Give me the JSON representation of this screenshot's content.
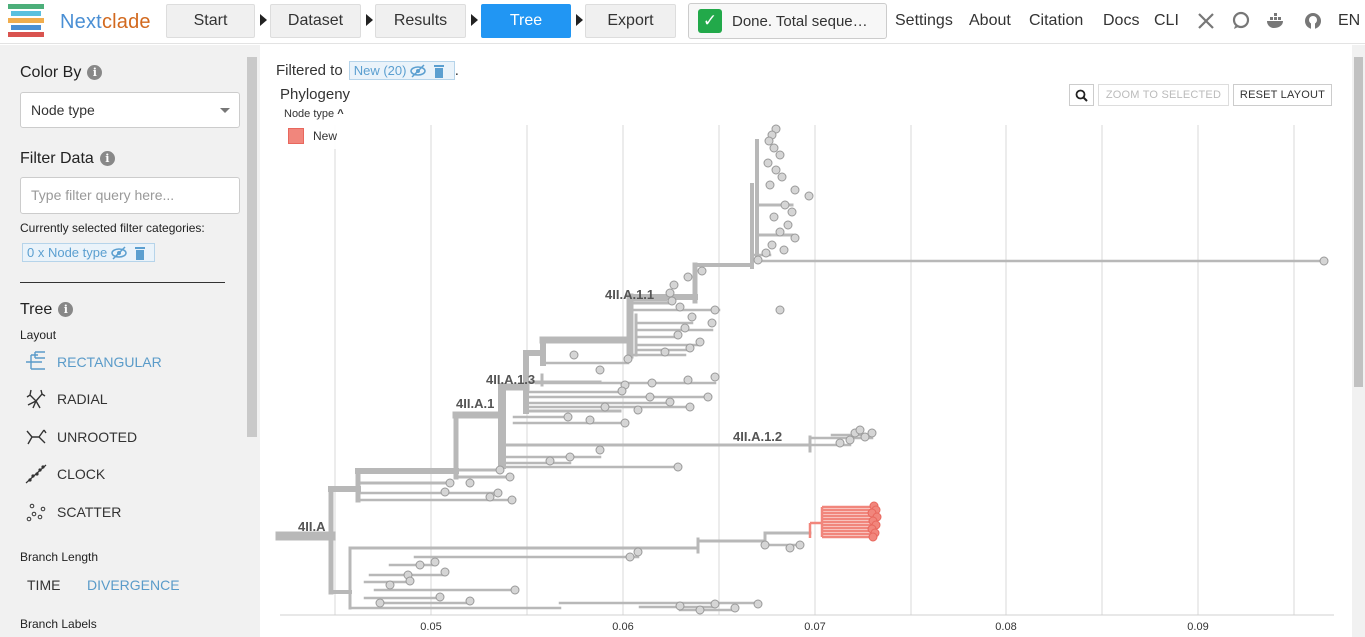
{
  "brand": {
    "part1": "Next",
    "part2": "clade"
  },
  "nav": {
    "steps": [
      "Start",
      "Dataset",
      "Results",
      "Tree",
      "Export"
    ],
    "active_step": "Tree",
    "status": "Done. Total seque…",
    "links": [
      "Settings",
      "About",
      "Citation",
      "Docs",
      "CLI"
    ],
    "icons": [
      "x-twitter-icon",
      "discussion-icon",
      "docker-icon",
      "github-icon"
    ],
    "language": "EN"
  },
  "sidebar": {
    "color_by": {
      "title": "Color By",
      "selected": "Node type"
    },
    "filter_data": {
      "title": "Filter Data",
      "placeholder": "Type filter query here...",
      "categories_label": "Currently selected filter categories:",
      "chip": "0 x Node type"
    },
    "tree": {
      "title": "Tree",
      "layout_label": "Layout",
      "layouts": [
        "RECTANGULAR",
        "RADIAL",
        "UNROOTED",
        "CLOCK",
        "SCATTER"
      ],
      "selected_layout": "RECTANGULAR",
      "branch_length_label": "Branch Length",
      "branch_length_options": [
        "TIME",
        "DIVERGENCE"
      ],
      "selected_branch_length": "DIVERGENCE",
      "branch_labels_label": "Branch Labels"
    }
  },
  "main": {
    "filtered_to_label": "Filtered to",
    "filter_chip": "New (20)",
    "filtered_suffix": ".",
    "panel_title": "Phylogeny",
    "legend_title": "Node type",
    "legend_items": [
      {
        "label": "New",
        "color": "#f1867c"
      }
    ],
    "zoom_to_selected": "ZOOM TO SELECTED",
    "reset_layout": "RESET LAYOUT",
    "clade_labels": [
      "4II.A",
      "4II.A.1",
      "4II.A.1.3",
      "4II.A.1.1",
      "4II.A.1.2"
    ],
    "x_ticks": [
      "0.05",
      "0.06",
      "0.07",
      "0.08",
      "0.09"
    ]
  },
  "colors": {
    "accent": "#2196f3",
    "branch": "#b8b8b8",
    "new_node": "#f1867c",
    "node": "#d5d5d5"
  }
}
